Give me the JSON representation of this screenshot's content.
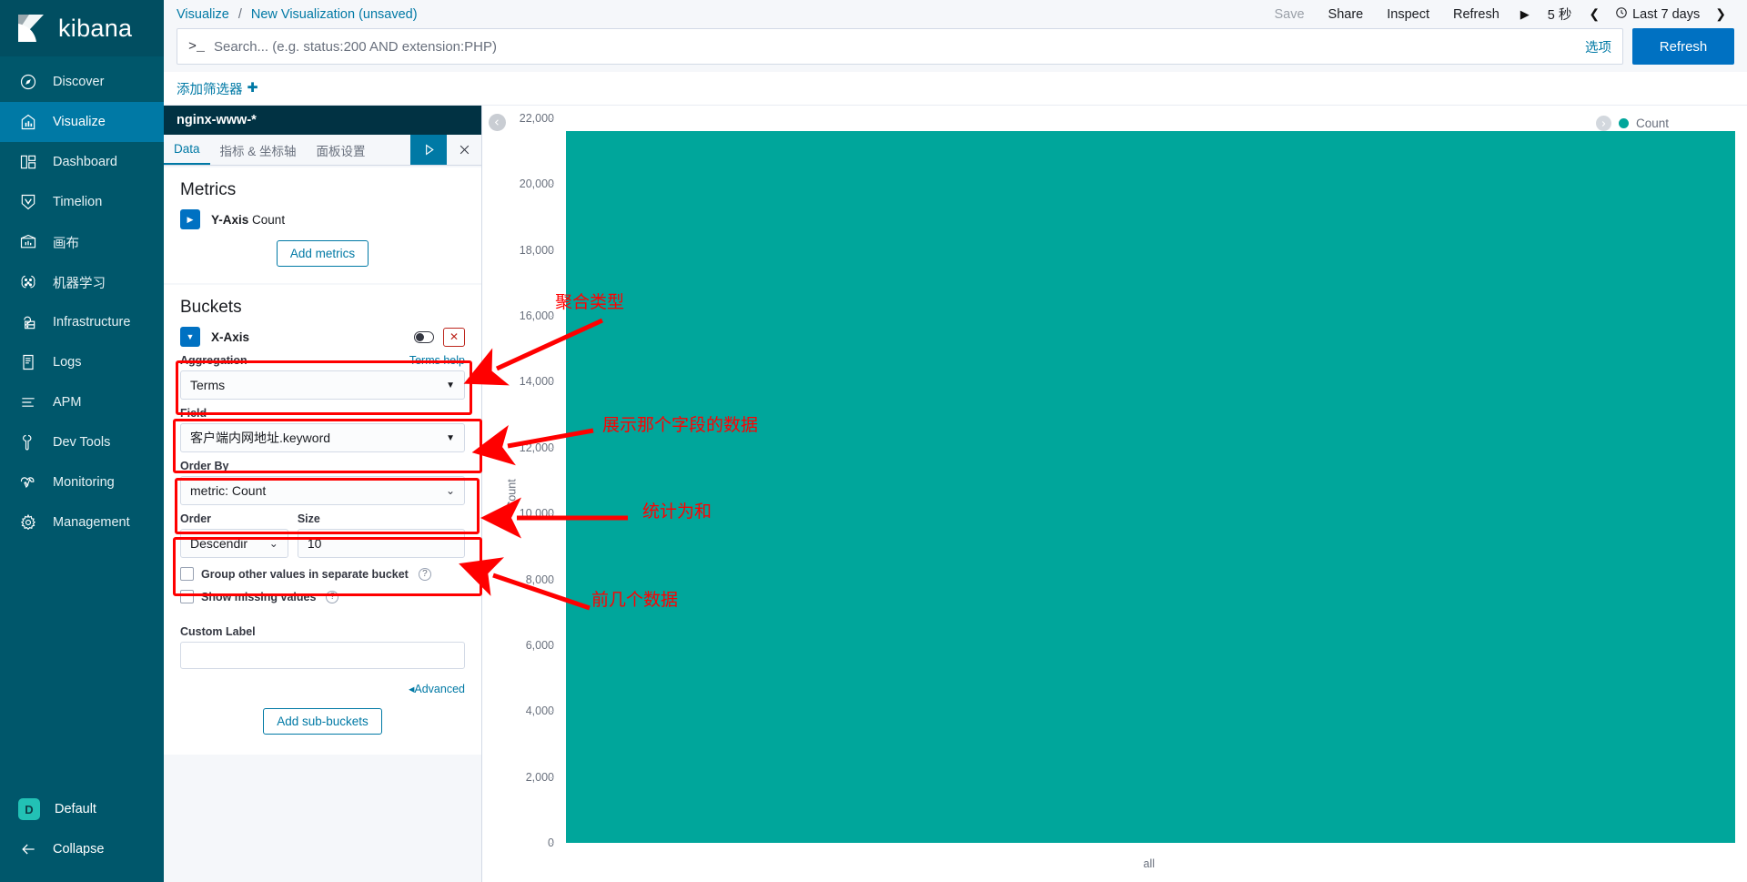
{
  "brand": {
    "name": "kibana",
    "logo_icon": "kibana-logo-icon"
  },
  "sidebar": {
    "items": [
      {
        "label": "Discover",
        "icon": "compass-icon",
        "active": false
      },
      {
        "label": "Visualize",
        "icon": "bar-chart-icon",
        "active": true
      },
      {
        "label": "Dashboard",
        "icon": "dashboard-icon",
        "active": false
      },
      {
        "label": "Timelion",
        "icon": "timelion-icon",
        "active": false
      },
      {
        "label": "画布",
        "icon": "canvas-icon",
        "active": false
      },
      {
        "label": "机器学习",
        "icon": "machine-learning-icon",
        "active": false
      },
      {
        "label": "Infrastructure",
        "icon": "infrastructure-icon",
        "active": false
      },
      {
        "label": "Logs",
        "icon": "logs-icon",
        "active": false
      },
      {
        "label": "APM",
        "icon": "apm-icon",
        "active": false
      },
      {
        "label": "Dev Tools",
        "icon": "wrench-icon",
        "active": false
      },
      {
        "label": "Monitoring",
        "icon": "heartbeat-icon",
        "active": false
      },
      {
        "label": "Management",
        "icon": "gear-icon",
        "active": false
      }
    ],
    "space": {
      "badge": "D",
      "label": "Default"
    },
    "collapse": {
      "label": "Collapse",
      "icon": "arrow-left-icon"
    }
  },
  "topbar": {
    "breadcrumb_root": "Visualize",
    "breadcrumb_sep": "/",
    "breadcrumb_current": "New Visualization (unsaved)",
    "save_label": "Save",
    "share_label": "Share",
    "inspect_label": "Inspect",
    "refresh_label": "Refresh",
    "play_icon": "play-icon",
    "interval_label": "5 秒",
    "prev_icon": "chevron-left-icon",
    "clock_icon": "clock-icon",
    "date_range": "Last 7 days",
    "next_icon": "chevron-right-icon"
  },
  "query": {
    "prompt": ">_",
    "placeholder": "Search... (e.g. status:200 AND extension:PHP)",
    "value": "",
    "options_label": "选项",
    "refresh_button": "Refresh"
  },
  "filters": {
    "add_label": "添加筛选器",
    "add_icon": "plus-icon"
  },
  "editor": {
    "index_title": "nginx-www-*",
    "tabs": [
      {
        "label": "Data",
        "active": true
      },
      {
        "label": "指标 & 坐标轴",
        "active": false
      },
      {
        "label": "面板设置",
        "active": false
      }
    ],
    "apply_icon": "play-icon",
    "close_icon": "close-icon",
    "metrics": {
      "heading": "Metrics",
      "expand_icon": "chevron-right-icon",
      "axis_label": "Y-Axis",
      "axis_value": "Count",
      "add_button": "Add metrics"
    },
    "buckets": {
      "heading": "Buckets",
      "collapse_icon": "chevron-down-icon",
      "axis_label": "X-Axis",
      "toggle_icon": "toggle-icon",
      "remove_icon": "remove-icon",
      "aggregation_label": "Aggregation",
      "aggregation_help": "Terms help",
      "aggregation_value": "Terms",
      "field_label": "Field",
      "field_value": "客户端内网地址.keyword",
      "order_by_label": "Order By",
      "order_by_value": "metric: Count",
      "order_label": "Order",
      "order_value": "Descendir",
      "size_label": "Size",
      "size_value": "10",
      "group_other_label": "Group other values in separate bucket",
      "show_missing_label": "Show missing values",
      "custom_label_label": "Custom Label",
      "custom_label_value": "",
      "advanced_label": "Advanced",
      "advanced_icon": "triangle-left-icon",
      "add_sub_buckets": "Add sub-buckets"
    }
  },
  "chart_panel": {
    "collapse_icon": "chevron-left-icon",
    "legend_toggle_icon": "chevron-right-icon",
    "legend_label": "Count",
    "legend_color": "#00a69b"
  },
  "chart_data": {
    "type": "bar",
    "title": "",
    "xlabel": "",
    "ylabel": "Count",
    "categories": [
      "all"
    ],
    "values": [
      21600
    ],
    "series": [
      {
        "name": "Count",
        "values": [
          21600
        ],
        "color": "#00a69b"
      }
    ],
    "ylim": [
      0,
      22000
    ],
    "yticks": [
      0,
      2000,
      4000,
      6000,
      8000,
      10000,
      12000,
      14000,
      16000,
      18000,
      20000,
      22000
    ],
    "ytick_labels": [
      "0",
      "2,000",
      "4,000",
      "6,000",
      "8,000",
      "10,000",
      "12,000",
      "14,000",
      "16,000",
      "18,000",
      "20,000",
      "22,000"
    ],
    "grid": false,
    "legend_position": "top-right"
  },
  "annotations": [
    {
      "id": "agg-type",
      "text": "聚合类型"
    },
    {
      "id": "field-data",
      "text": "展示那个字段的数据"
    },
    {
      "id": "order-by-sum",
      "text": "统计为和"
    },
    {
      "id": "size-topn",
      "text": "前几个数据"
    }
  ]
}
